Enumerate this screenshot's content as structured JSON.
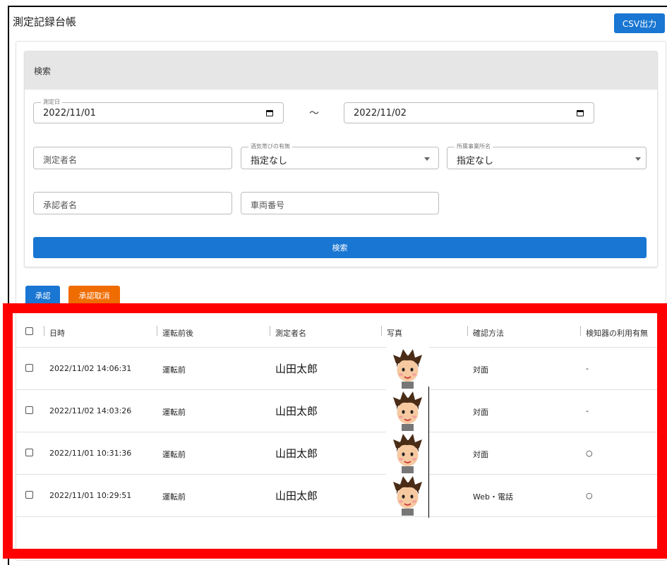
{
  "header": {
    "title": "測定記録台帳",
    "csv_button": "CSV出力"
  },
  "search": {
    "heading": "検索",
    "date_label": "測定日",
    "date_from": "2022/11/01",
    "date_to": "2022/11/02",
    "tilde": "～",
    "measurer_placeholder": "測定者名",
    "alcohol_label": "酒気帯びの有無",
    "alcohol_value": "指定なし",
    "office_label": "所属事業所名",
    "office_value": "指定なし",
    "approver_placeholder": "承認者名",
    "vehicle_placeholder": "車両番号",
    "search_button": "検索"
  },
  "actions": {
    "approve": "承認",
    "cancel_approve": "承認取消"
  },
  "table": {
    "headers": [
      "日時",
      "運転前後",
      "測定者名",
      "写真",
      "確認方法",
      "検知器の利用有無"
    ],
    "rows": [
      {
        "datetime": "2022/11/02 14:06:31",
        "timing": "運転前",
        "name": "山田太郎",
        "method": "対面",
        "detector": "-"
      },
      {
        "datetime": "2022/11/02 14:03:26",
        "timing": "運転前",
        "name": "山田太郎",
        "method": "対面",
        "detector": "-"
      },
      {
        "datetime": "2022/11/01 10:31:36",
        "timing": "運転前",
        "name": "山田太郎",
        "method": "対面",
        "detector": "○"
      },
      {
        "datetime": "2022/11/01 10:29:51",
        "timing": "運転前",
        "name": "山田太郎",
        "method": "Web・電話",
        "detector": "○"
      }
    ]
  },
  "colors": {
    "primary": "#1976d2",
    "warning": "#ef6c00",
    "highlight": "#ff0000"
  },
  "icons": [
    "calendar-icon",
    "chevron-down-icon",
    "checkbox-icon",
    "avatar"
  ]
}
